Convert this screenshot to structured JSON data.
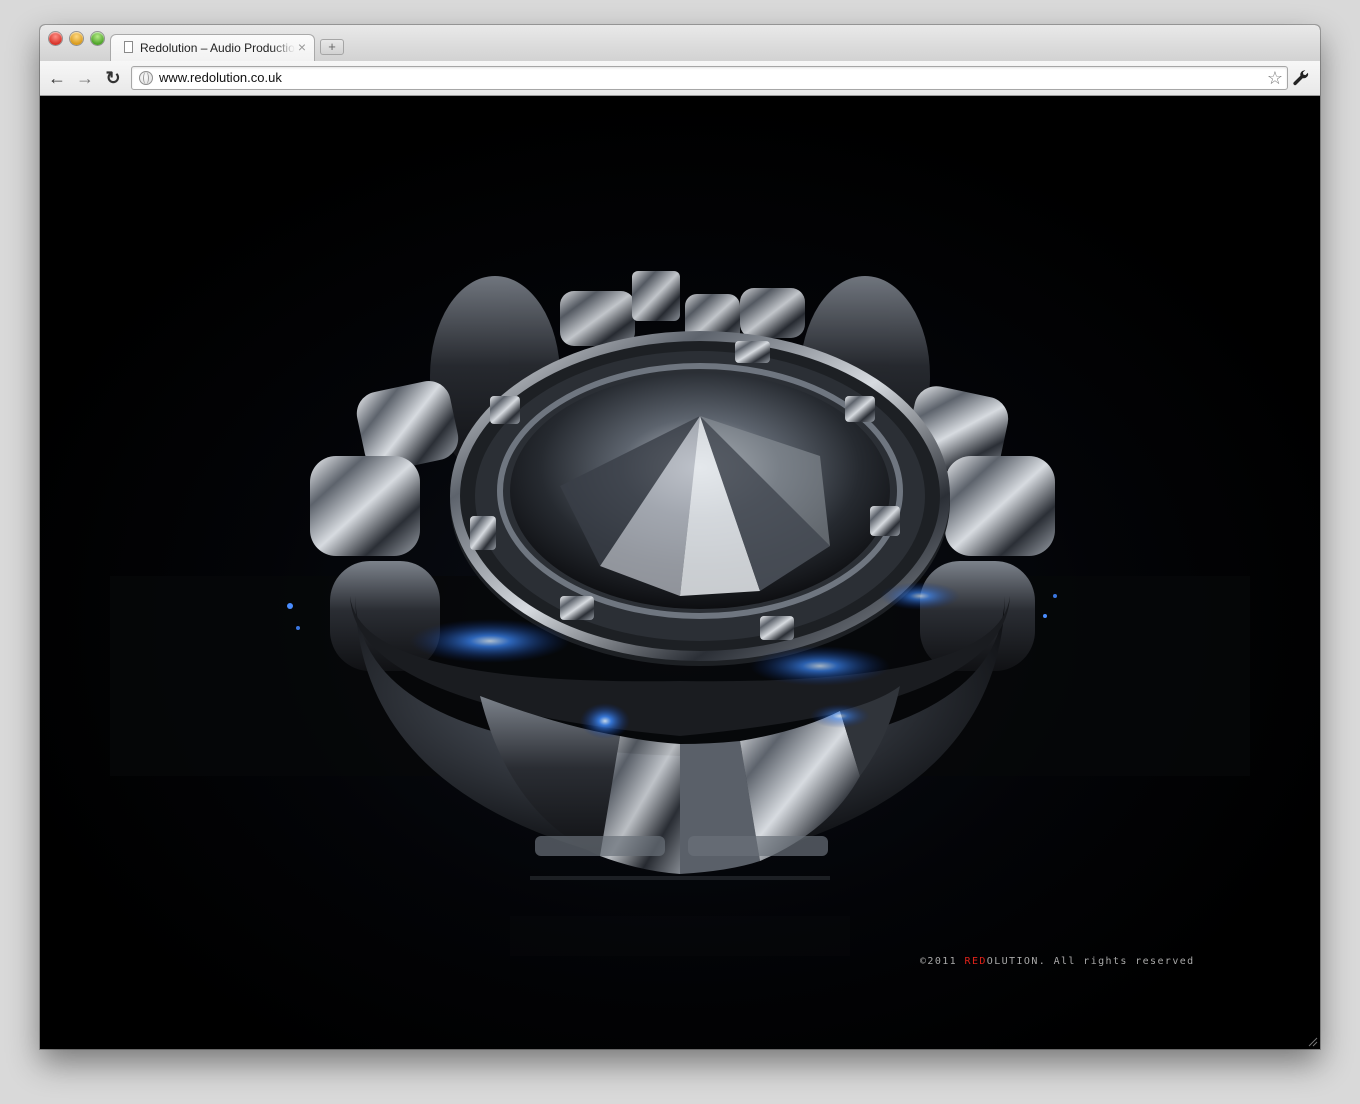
{
  "browser": {
    "tab": {
      "title": "Redolution – Audio Production",
      "close_glyph": "×"
    },
    "new_tab_glyph": "+",
    "nav": {
      "back_glyph": "←",
      "forward_glyph": "→",
      "reload_glyph": "↻"
    },
    "address_bar": {
      "url": "www.redolution.co.uk"
    },
    "star_glyph": "☆"
  },
  "page": {
    "footer": {
      "copyright_prefix": "©2011 ",
      "brand_red": "RED",
      "brand_rest": "OLUTION",
      "rights": ". All rights reserved"
    }
  },
  "colors": {
    "background": "#000000",
    "brand_red": "#e0231a",
    "glow_blue": "#2f7dff",
    "footer_text": "#a8a8a8"
  }
}
